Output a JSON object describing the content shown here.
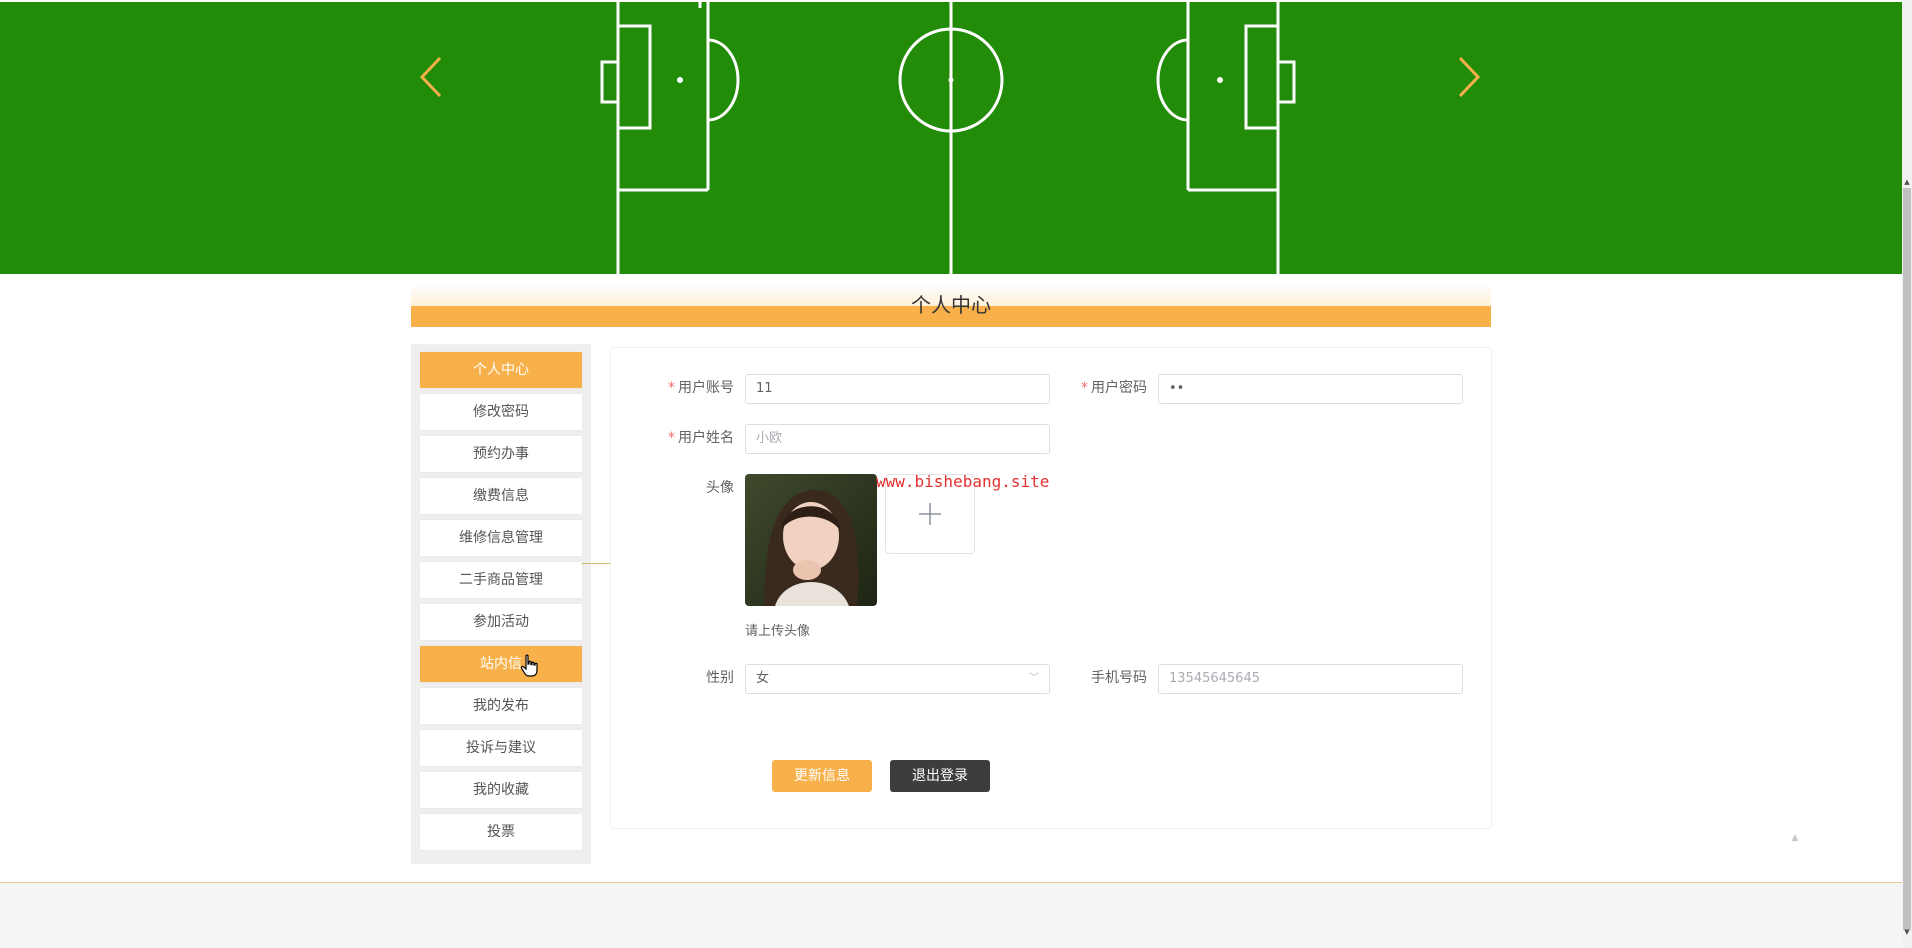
{
  "page": {
    "title": "个人中心"
  },
  "banner": {
    "prev_icon": "chevron-left-icon",
    "next_icon": "chevron-right-icon"
  },
  "sidebar": {
    "items": [
      {
        "label": "个人中心",
        "active": true
      },
      {
        "label": "修改密码",
        "active": false
      },
      {
        "label": "预约办事",
        "active": false
      },
      {
        "label": "缴费信息",
        "active": false
      },
      {
        "label": "维修信息管理",
        "active": false
      },
      {
        "label": "二手商品管理",
        "active": false
      },
      {
        "label": "参加活动",
        "active": false
      },
      {
        "label": "站内信",
        "active": true
      },
      {
        "label": "我的发布",
        "active": false
      },
      {
        "label": "投诉与建议",
        "active": false
      },
      {
        "label": "我的收藏",
        "active": false
      },
      {
        "label": "投票",
        "active": false
      }
    ]
  },
  "form": {
    "account": {
      "label": "用户账号",
      "required": "*",
      "value": "11"
    },
    "password": {
      "label": "用户密码",
      "required": "*",
      "value": "••"
    },
    "name": {
      "label": "用户姓名",
      "required": "*",
      "value": "小欧"
    },
    "avatar": {
      "label": "头像",
      "hint": "请上传头像",
      "upload_icon": "plus-icon"
    },
    "gender": {
      "label": "性别",
      "value": "女"
    },
    "phone": {
      "label": "手机号码",
      "value": "13545645645"
    }
  },
  "buttons": {
    "update": "更新信息",
    "logout": "退出登录"
  },
  "watermark": "www.bishebang.site",
  "colors": {
    "accent": "#f7b04a",
    "banner": "#228b08",
    "dark_button": "#3d3d3d",
    "required": "#f56c6c",
    "watermark": "#e53030"
  }
}
